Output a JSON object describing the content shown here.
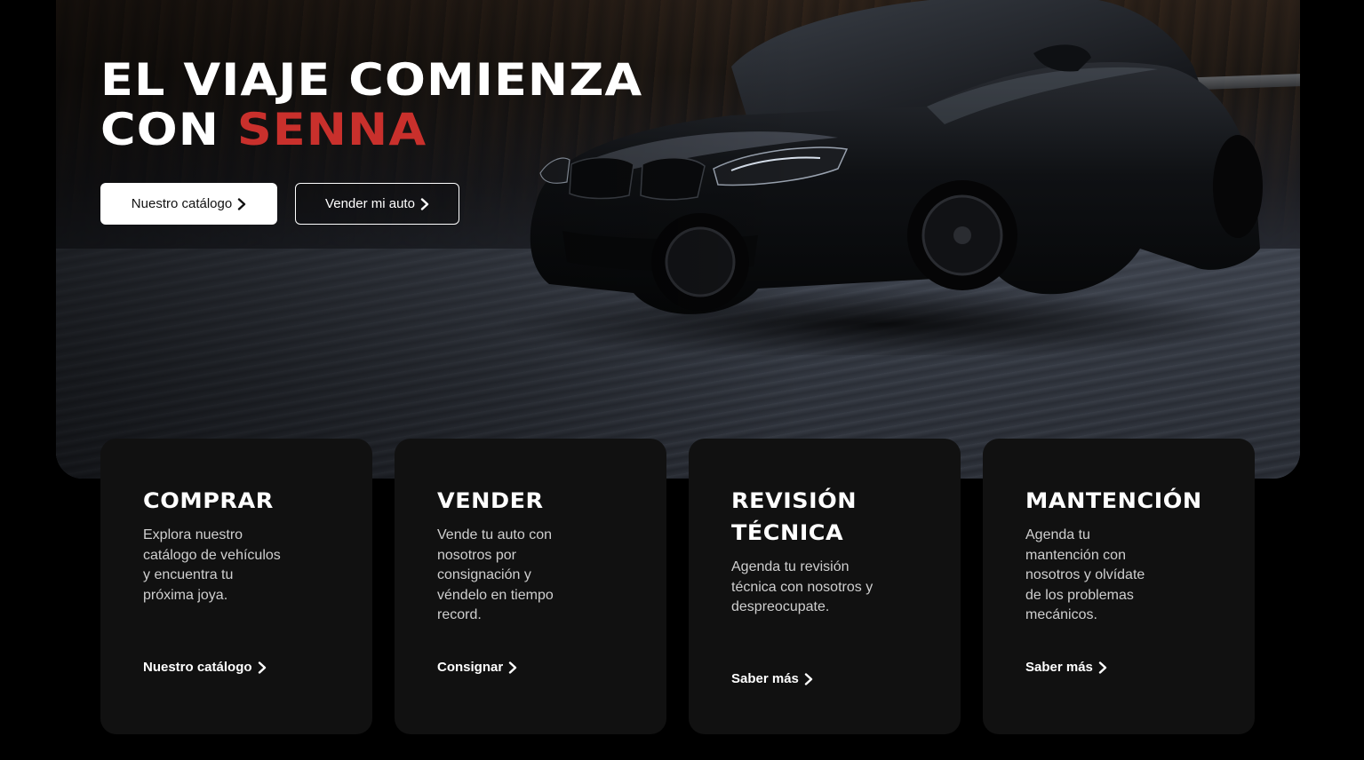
{
  "hero": {
    "title_line1": "EL VIAJE COMIENZA",
    "title_line2_prefix": "CON ",
    "title_line2_accent": "SENNA",
    "accent_color": "#c9302c",
    "buttons": {
      "catalog_label": "Nuestro catálogo",
      "sell_label": "Vender mi auto"
    },
    "background_image": "black-sports-coupe-on-road"
  },
  "cards": [
    {
      "title": "COMPRAR",
      "description": "Explora nuestro catálogo de vehículos y encuentra tu próxima joya.",
      "link_label": "Nuestro catálogo"
    },
    {
      "title": "VENDER",
      "description": "Vende tu auto con nosotros por consignación y véndelo en tiempo record.",
      "link_label": "Consignar"
    },
    {
      "title_line1": "REVISIÓN",
      "title_line2": "TÉCNICA",
      "description": "Agenda tu revisión técnica con nosotros y despreocupate.",
      "link_label": "Saber más"
    },
    {
      "title": "MANTENCIÓN",
      "description": "Agenda tu mantención con nosotros y olvídate de los problemas mecánicos.",
      "link_label": "Saber más"
    }
  ],
  "icons": {
    "chevron": "chevron-right-icon"
  }
}
